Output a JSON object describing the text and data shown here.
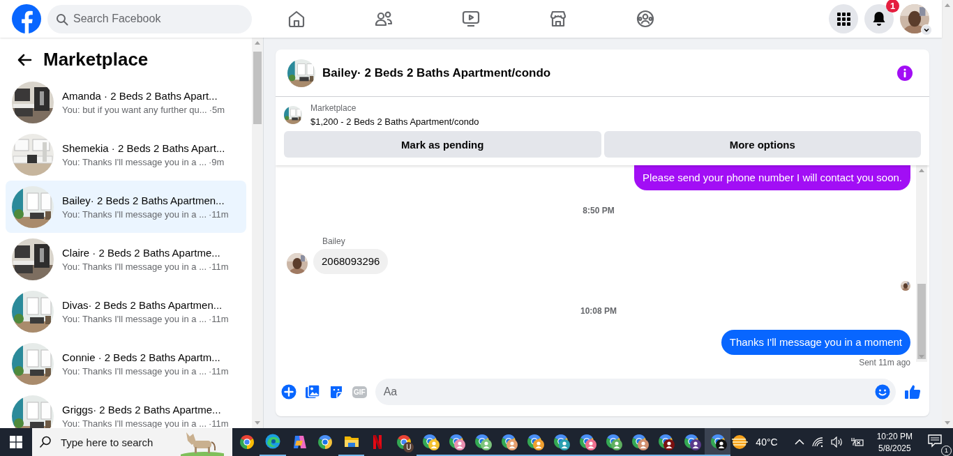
{
  "nav": {
    "search_placeholder": "Search Facebook",
    "tabs": [
      {
        "kind": "home",
        "selected": false
      },
      {
        "kind": "friends",
        "selected": false
      },
      {
        "kind": "video",
        "selected": false
      },
      {
        "kind": "marketplace",
        "selected": false
      },
      {
        "kind": "groups",
        "selected": false
      }
    ],
    "notification_count": "1"
  },
  "sidebar": {
    "title": "Marketplace",
    "conversations": [
      {
        "name": "Amanda · 2 Beds 2 Baths Apart...",
        "preview": "You: but if you want any further qu...",
        "time": "·5m",
        "selected": false
      },
      {
        "name": "Shemekia · 2 Beds 2 Baths Apart...",
        "preview": "You: Thanks I'll message you in a ...",
        "time": "·9m",
        "selected": false
      },
      {
        "name": "Bailey· 2 Beds 2 Baths Apartmen...",
        "preview": "You: Thanks I'll message you in a ...",
        "time": "·11m",
        "selected": true
      },
      {
        "name": "Claire · 2 Beds 2 Baths Apartme...",
        "preview": "You: Thanks I'll message you in a ...",
        "time": "·11m",
        "selected": false
      },
      {
        "name": "Divas· 2 Beds 2 Baths Apartmen...",
        "preview": "You: Thanks I'll message you in a ...",
        "time": "·11m",
        "selected": false
      },
      {
        "name": "Connie · 2 Beds 2 Baths Apartm...",
        "preview": "You: Thanks I'll message you in a ...",
        "time": "·11m",
        "selected": false
      },
      {
        "name": "Griggs· 2 Beds 2 Baths Apartme...",
        "preview": "You: Thanks I'll message you in a ...",
        "time": "·11m",
        "selected": false
      }
    ]
  },
  "chat": {
    "title": "Bailey· 2 Beds 2 Baths Apartment/condo",
    "listing": {
      "source": "Marketplace",
      "summary": "$1,200 - 2 Beds 2 Baths Apartment/condo"
    },
    "actions": [
      "Mark as pending",
      "More options"
    ],
    "messages": [
      {
        "kind": "sent",
        "color": "#a20ef5",
        "lines": [
          "Please send your phone number I will contact you soon."
        ]
      },
      {
        "kind": "time",
        "text": "8:50 PM"
      },
      {
        "kind": "received",
        "sender": "Bailey",
        "lines": [
          "2068093296"
        ]
      },
      {
        "kind": "seen"
      },
      {
        "kind": "time",
        "text": "10:08 PM"
      },
      {
        "kind": "sent",
        "color": "#0866ff",
        "lines": [
          "Thanks I'll message you in a moment"
        ]
      },
      {
        "kind": "status",
        "text": "Sent 11m ago"
      }
    ],
    "composer": {
      "gif_label": "GIF",
      "placeholder": "Aa"
    }
  },
  "taskbar": {
    "search_placeholder": "Type here to search",
    "apps": [
      {
        "kind": "chrome",
        "running": false,
        "selected": false
      },
      {
        "kind": "edge",
        "running": true,
        "selected": false
      },
      {
        "kind": "copilot",
        "running": false,
        "selected": false
      },
      {
        "kind": "chrome-blue",
        "running": false,
        "selected": false
      },
      {
        "kind": "files",
        "running": true,
        "selected": false
      },
      {
        "kind": "netflix",
        "running": false,
        "selected": false
      },
      {
        "kind": "chrome-letter",
        "badge": "U",
        "running": false,
        "selected": false
      },
      {
        "kind": "profile",
        "color": "#f2c230",
        "running": true,
        "selected": false
      },
      {
        "kind": "profile",
        "color": "#ea8fb0",
        "running": true,
        "selected": false
      },
      {
        "kind": "profile",
        "color": "#7cc47c",
        "running": true,
        "selected": false
      },
      {
        "kind": "profile",
        "color": "#e8a070",
        "running": true,
        "selected": false
      },
      {
        "kind": "profile",
        "color": "#f0a030",
        "running": true,
        "selected": false
      },
      {
        "kind": "profile",
        "color": "#2aa0b0",
        "running": true,
        "selected": false
      },
      {
        "kind": "profile",
        "color": "#f07090",
        "running": true,
        "selected": false
      },
      {
        "kind": "profile",
        "color": "#5fb060",
        "running": true,
        "selected": false
      },
      {
        "kind": "profile",
        "color": "#d09070",
        "running": true,
        "selected": false
      },
      {
        "kind": "profile",
        "color": "#7a1010",
        "running": true,
        "selected": false
      },
      {
        "kind": "profile",
        "color": "#5a3a8a",
        "running": true,
        "selected": false
      },
      {
        "kind": "profile",
        "color": "#111111",
        "running": true,
        "selected": true
      }
    ],
    "temperature": "40°C",
    "time": "10:20 PM",
    "date": "5/8/2025",
    "notification_count": "1"
  }
}
